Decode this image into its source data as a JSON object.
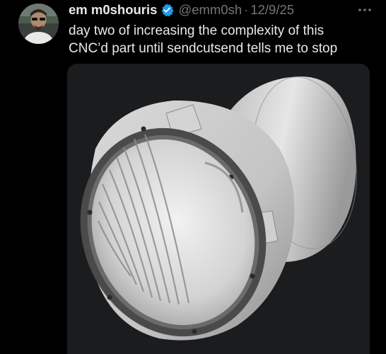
{
  "tweet": {
    "author": {
      "display_name": "em m0shouris",
      "verified": true,
      "verified_icon": "verified-badge-icon",
      "handle": "@emm0sh",
      "separator": "·",
      "date": "12/9/25"
    },
    "more_icon": "more-options-icon",
    "text_lines": [
      "day two of increasing the complexity of this",
      "CNC’d part until sendcutsend tells me to stop"
    ],
    "media": {
      "kind": "3d-render",
      "background_color": "#1b1c1e"
    }
  },
  "colors": {
    "background": "#000000",
    "text_primary": "#e7e9ea",
    "text_secondary": "#71767b",
    "verified_blue": "#1d9bf0"
  }
}
